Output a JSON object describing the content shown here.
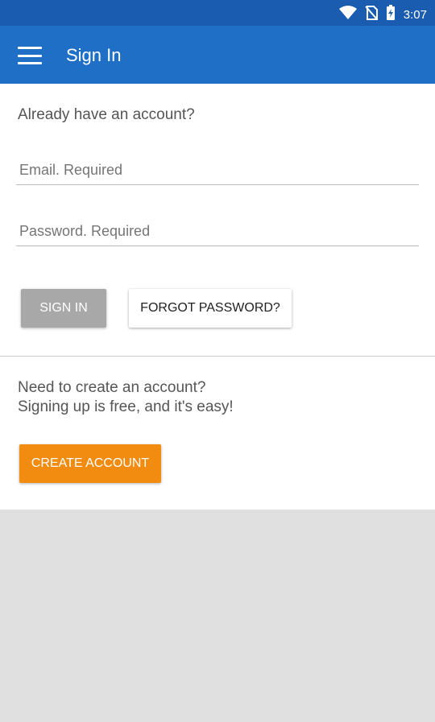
{
  "status": {
    "time": "3:07"
  },
  "appbar": {
    "title": "Sign In",
    "menu_icon": "menu-icon"
  },
  "form": {
    "prompt": "Already have an account?",
    "email_placeholder": "Email. Required",
    "password_placeholder": "Password. Required",
    "sign_in": "SIGN IN",
    "forgot": "FORGOT PASSWORD?"
  },
  "signup": {
    "line1": "Need to create an account?",
    "line2": "Signing up is free, and it's easy!",
    "create": "CREATE ACCOUNT"
  },
  "colors": {
    "appbar": "#1f6fc7",
    "statusbar": "#1a5cb0",
    "accent": "#f18c10"
  }
}
